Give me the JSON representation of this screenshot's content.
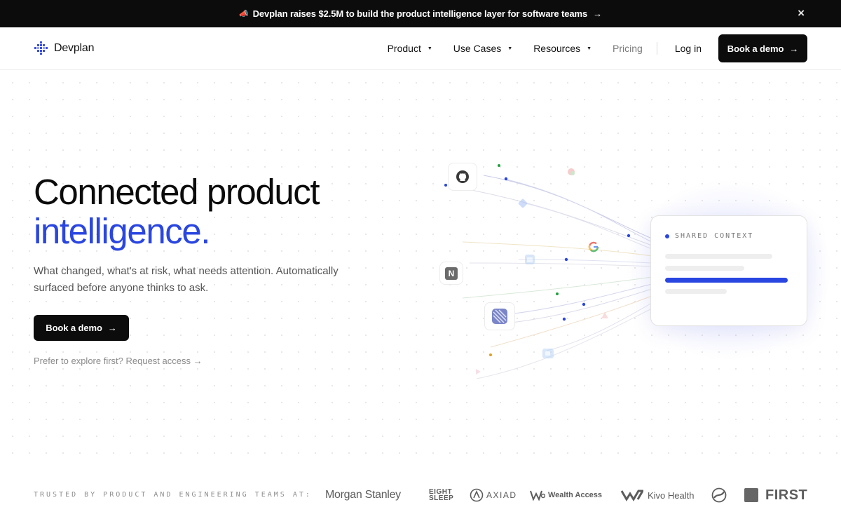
{
  "announcement": {
    "text": "Devplan raises $2.5M to build the product intelligence layer for software teams",
    "arrow": "→",
    "close": "×"
  },
  "nav": {
    "brand": "Devplan",
    "items": [
      {
        "label": "Product",
        "caret": "▼"
      },
      {
        "label": "Use Cases",
        "caret": "▼"
      },
      {
        "label": "Resources",
        "caret": "▼"
      },
      {
        "label": "Pricing"
      }
    ],
    "login": "Log in",
    "cta": "Book a demo",
    "cta_arrow": "→"
  },
  "hero": {
    "title_line1": "Connected product",
    "title_line2": "intelligence.",
    "subtitle": "What changed, what's at risk, what needs attention. Automatically surfaced before anyone thinks to ask.",
    "cta": "Book a demo",
    "cta_arrow": "→",
    "secondary": "Prefer to explore first? Request access →"
  },
  "illustration": {
    "context_label": "SHARED CONTEXT",
    "notion_glyph": "N",
    "icons": [
      "github-icon",
      "notion-icon",
      "linear-icon",
      "google-icon",
      "jira-icon",
      "slack-icon",
      "figma-icon",
      "zoom-icon"
    ]
  },
  "trusted": {
    "label": "TRUSTED BY PRODUCT AND ENGINEERING TEAMS AT:",
    "logos": {
      "morgan_stanley": "Morgan Stanley",
      "eight_sleep_1": "EIGHT",
      "eight_sleep_2": "SLEEP",
      "axiad": "AXIAD",
      "wealth_access": "Wealth Access",
      "kivo": "Kivo Health",
      "first": "FIRST"
    }
  },
  "colors": {
    "accent": "#2a46e0",
    "dark": "#0c0c0c",
    "muted": "#555555"
  }
}
